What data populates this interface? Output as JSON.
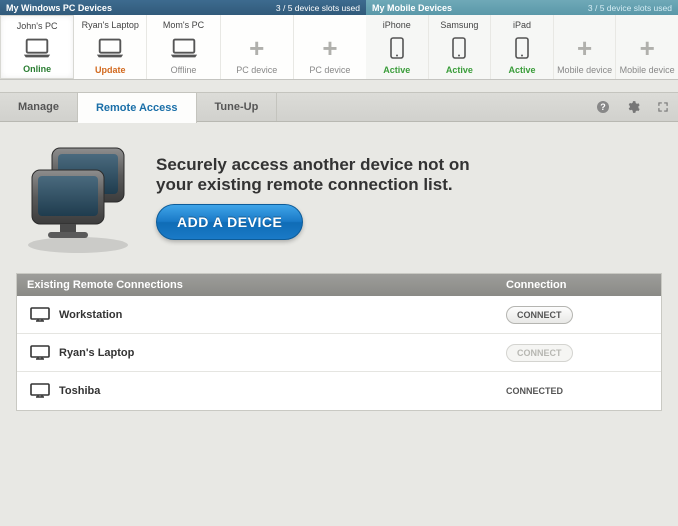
{
  "pc_section": {
    "title": "My Windows PC Devices",
    "slots": "3 / 5 device slots used",
    "devices": [
      {
        "label": "John's PC",
        "status": "Online",
        "status_class": "status-online",
        "kind": "laptop",
        "selected": true
      },
      {
        "label": "Ryan's Laptop",
        "status": "Update",
        "status_class": "status-update",
        "kind": "laptop"
      },
      {
        "label": "Mom's PC",
        "status": "Offline",
        "status_class": "status-offline",
        "kind": "laptop"
      },
      {
        "label": "",
        "status": "PC device",
        "status_class": "status-slot",
        "kind": "slot"
      },
      {
        "label": "",
        "status": "PC device",
        "status_class": "status-slot",
        "kind": "slot"
      }
    ]
  },
  "mobile_section": {
    "title": "My Mobile Devices",
    "slots": "3 / 5 device slots used",
    "devices": [
      {
        "label": "iPhone",
        "status": "Active",
        "status_class": "status-active",
        "kind": "phone"
      },
      {
        "label": "Samsung",
        "status": "Active",
        "status_class": "status-active",
        "kind": "phone"
      },
      {
        "label": "iPad",
        "status": "Active",
        "status_class": "status-active",
        "kind": "phone"
      },
      {
        "label": "",
        "status": "Mobile device",
        "status_class": "status-slot",
        "kind": "slot"
      },
      {
        "label": "",
        "status": "Mobile device",
        "status_class": "status-slot",
        "kind": "slot"
      }
    ]
  },
  "tabs": {
    "items": [
      "Manage",
      "Remote Access",
      "Tune-Up"
    ],
    "active_index": 1
  },
  "hero": {
    "line1": "Securely access another device not on",
    "line2": "your existing remote connection list.",
    "button": "ADD A DEVICE"
  },
  "table": {
    "header_name": "Existing Remote Connections",
    "header_conn": "Connection",
    "rows": [
      {
        "name": "Workstation",
        "state": "connect"
      },
      {
        "name": "Ryan's Laptop",
        "state": "connect-disabled"
      },
      {
        "name": "Toshiba",
        "state": "connected"
      }
    ],
    "connect_label": "CONNECT",
    "connected_label": "CONNECTED"
  }
}
